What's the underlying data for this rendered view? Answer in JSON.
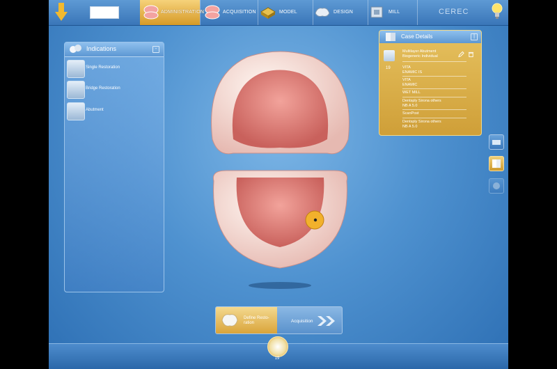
{
  "app": {
    "brand": "CEREC"
  },
  "workflow": {
    "steps": [
      {
        "label": "ADMINISTRATION",
        "icon": "administration-jaw-icon",
        "active": true
      },
      {
        "label": "ACQUISITION",
        "icon": "acquisition-jaw-icon",
        "active": false
      },
      {
        "label": "MODEL",
        "icon": "model-icon",
        "active": false
      },
      {
        "label": "DESIGN",
        "icon": "design-icon",
        "active": false
      },
      {
        "label": "MILL",
        "icon": "mill-icon",
        "active": false
      }
    ]
  },
  "indications": {
    "title": "Indications",
    "items": [
      {
        "label": "Single Restoration",
        "icon": "single-restoration-icon"
      },
      {
        "label": "Bridge Restoration",
        "icon": "bridge-restoration-icon"
      },
      {
        "label": "Abutment",
        "icon": "abutment-icon"
      }
    ]
  },
  "case_details": {
    "title": "Case Details",
    "tooth_number": "19",
    "rows": [
      [
        "Multilayer Abutment",
        "Biogeneric Individual"
      ],
      [
        "VITA",
        "ENAMIC IS"
      ],
      [
        "VITA",
        "ENAMIC"
      ],
      [
        "WET MILL"
      ],
      [
        "Dentsply Sirona others",
        "NB A 5.0"
      ],
      [
        "ScanPost"
      ],
      [
        "Dentsply Sirona others",
        "NB A 5.0"
      ]
    ]
  },
  "bottom": {
    "define_label": "Define Resto-ration",
    "next_label": "Acquisition",
    "selected_tooth": "19"
  },
  "colors": {
    "accent_gold": "#e2b04a",
    "panel_blue": "#5d98d3"
  }
}
